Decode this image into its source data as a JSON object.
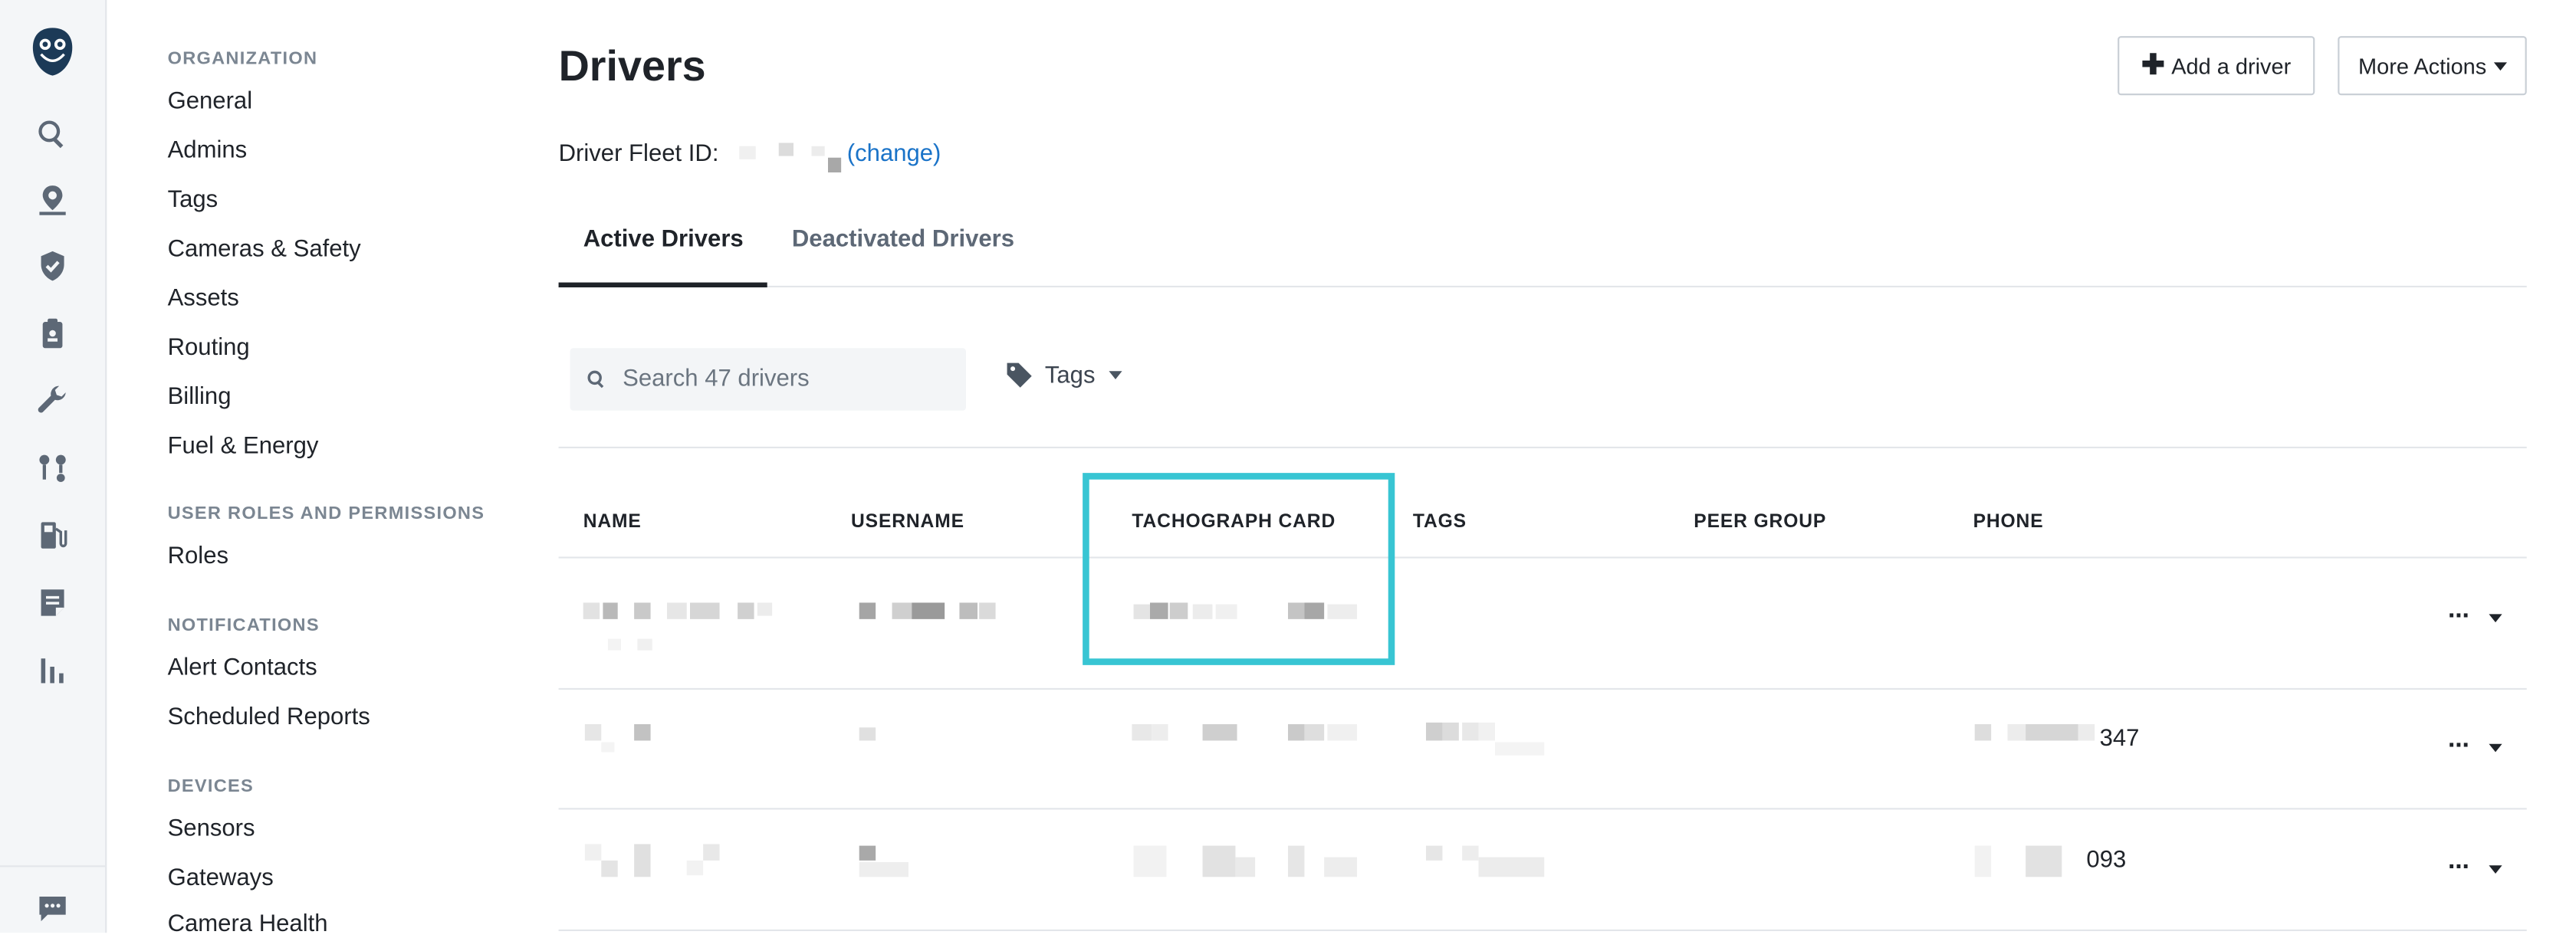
{
  "nav": {
    "sections": [
      {
        "title": "ORGANIZATION",
        "items": [
          "General",
          "Admins",
          "Tags",
          "Cameras & Safety",
          "Assets",
          "Routing",
          "Billing",
          "Fuel & Energy"
        ]
      },
      {
        "title": "USER ROLES AND PERMISSIONS",
        "items": [
          "Roles"
        ]
      },
      {
        "title": "NOTIFICATIONS",
        "items": [
          "Alert Contacts",
          "Scheduled Reports"
        ]
      },
      {
        "title": "DEVICES",
        "items": [
          "Sensors",
          "Gateways",
          "Camera Health"
        ]
      }
    ]
  },
  "rail_icons": [
    "owl-logo-icon",
    "search-icon",
    "map-pin-icon",
    "shield-icon",
    "clipboard-icon",
    "wrench-icon",
    "route-icon",
    "fuel-icon",
    "document-icon",
    "bar-chart-icon",
    "chat-icon"
  ],
  "page": {
    "title": "Drivers",
    "fleet_label": "Driver Fleet ID:",
    "fleet_change": "(change)",
    "add_button": "Add a driver",
    "more_button": "More Actions"
  },
  "tabs": {
    "active": "Active Drivers",
    "inactive": "Deactivated Drivers"
  },
  "search": {
    "placeholder": "Search 47 drivers"
  },
  "tags_filter": {
    "label": "Tags"
  },
  "table": {
    "columns": [
      "NAME",
      "USERNAME",
      "TACHOGRAPH CARD",
      "TAGS",
      "PEER GROUP",
      "PHONE"
    ],
    "rows": [
      {
        "phone_suffix": ""
      },
      {
        "phone_suffix": "347"
      },
      {
        "phone_suffix": "093"
      }
    ]
  },
  "colors": {
    "accent_link": "#1a73c8",
    "highlight": "#38c5d3"
  }
}
